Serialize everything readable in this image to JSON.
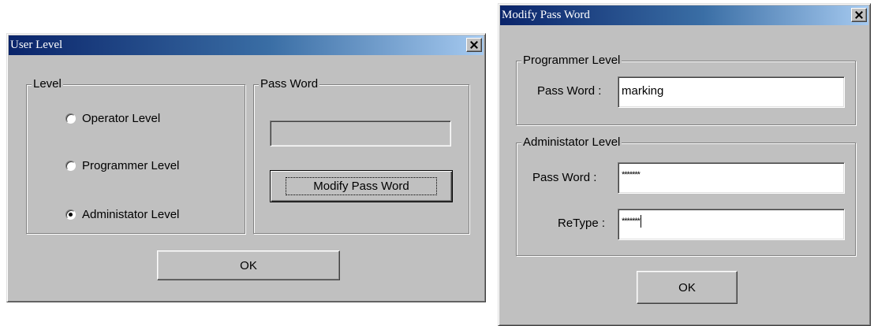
{
  "user_level_dialog": {
    "title": "User Level",
    "level_group": {
      "legend": "Level",
      "options": [
        {
          "label": "Operator Level",
          "selected": false
        },
        {
          "label": "Programmer Level",
          "selected": false
        },
        {
          "label": "Administator Level",
          "selected": true
        }
      ]
    },
    "password_group": {
      "legend": "Pass Word",
      "password_value": "",
      "modify_button_label": "Modify Pass Word"
    },
    "ok_label": "OK"
  },
  "modify_password_dialog": {
    "title": "Modify Pass Word",
    "programmer_group": {
      "legend": "Programmer Level",
      "password_label": "Pass Word :",
      "password_value": "marking"
    },
    "administrator_group": {
      "legend": "Administator Level",
      "password_label": "Pass Word :",
      "password_value": "*******",
      "retype_label": "ReType :",
      "retype_value": "*******"
    },
    "ok_label": "OK"
  },
  "icons": {
    "close": "close-icon"
  }
}
